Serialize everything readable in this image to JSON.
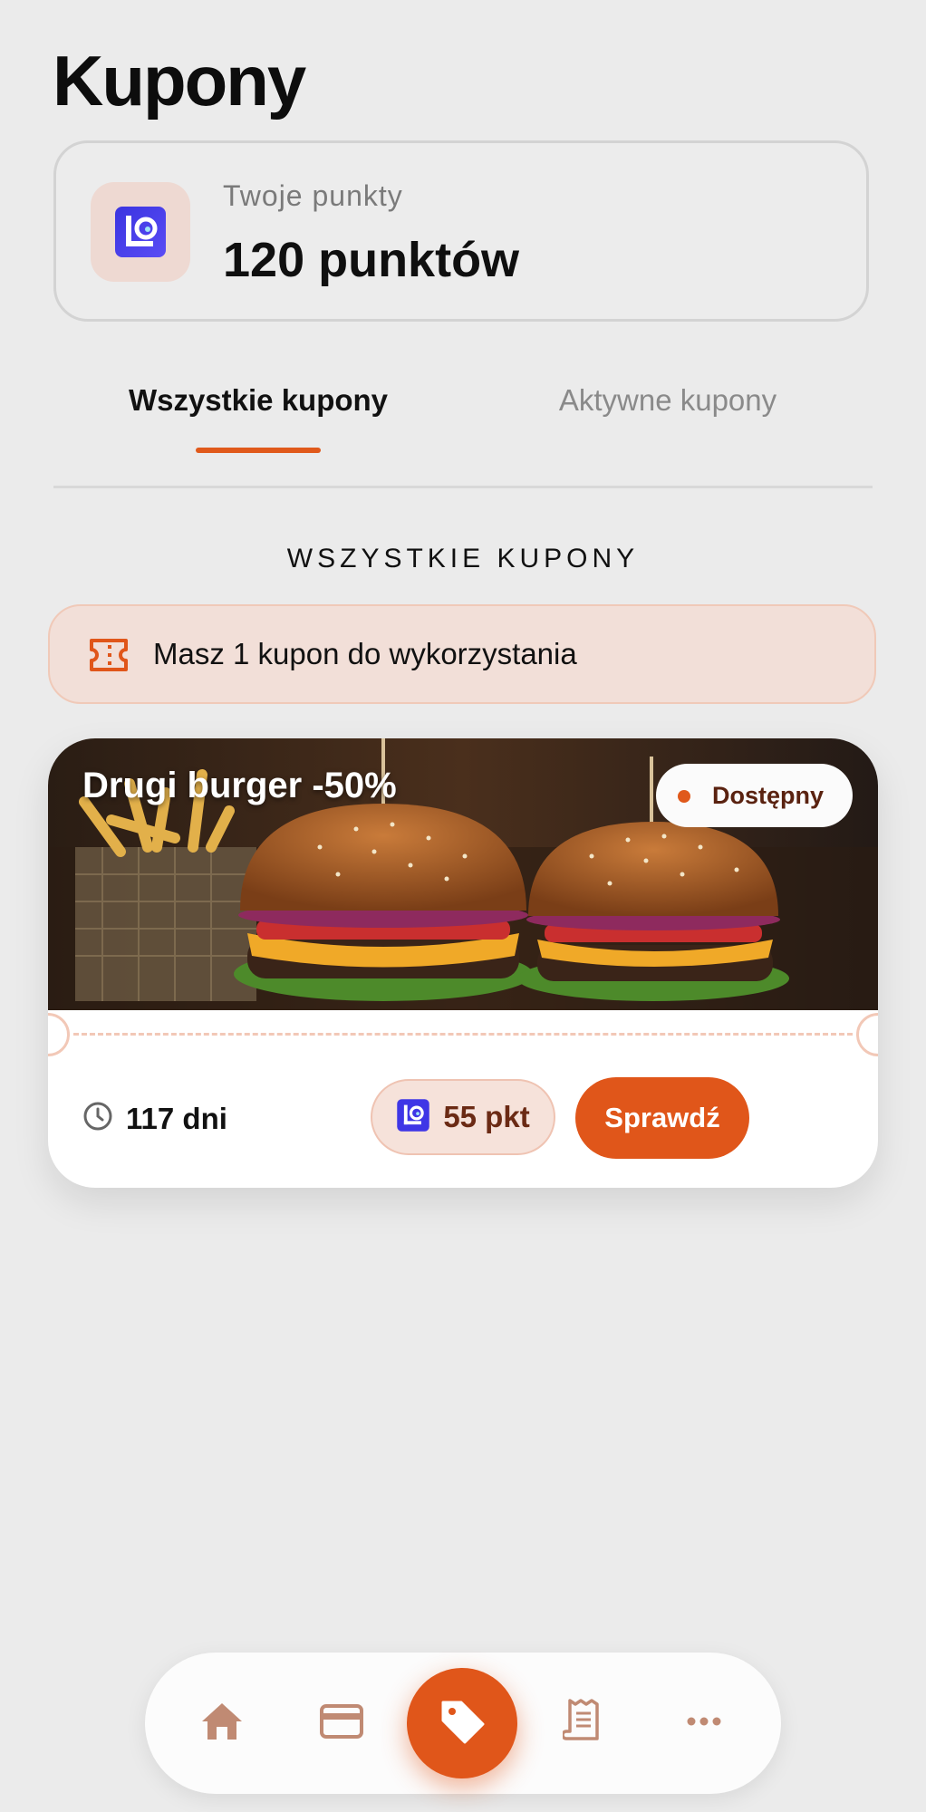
{
  "page": {
    "title": "Kupony"
  },
  "points": {
    "label": "Twoje punkty",
    "value": "120 punktów"
  },
  "tabs": [
    {
      "label": "Wszystkie kupony",
      "selected": true
    },
    {
      "label": "Aktywne kupony",
      "selected": false
    }
  ],
  "section": {
    "title": "WSZYSTKIE KUPONY"
  },
  "banner": {
    "icon": "ticket-icon",
    "text": "Masz 1 kupon do wykorzystania"
  },
  "coupon": {
    "title": "Drugi burger -50%",
    "status": "Dostępny",
    "expiry": "117 dni",
    "cost": "55 pkt",
    "action_label": "Sprawdź",
    "image": "burger-photo"
  },
  "bottom_nav": [
    {
      "icon": "home-icon"
    },
    {
      "icon": "credit-card-icon"
    },
    {
      "icon": "tag-icon",
      "active": true
    },
    {
      "icon": "receipt-icon"
    },
    {
      "icon": "more-icon"
    }
  ],
  "colors": {
    "accent": "#e0561a",
    "background": "#ebebeb",
    "banner_bg": "#f2dfd8",
    "nav_icon": "#c08a73"
  }
}
